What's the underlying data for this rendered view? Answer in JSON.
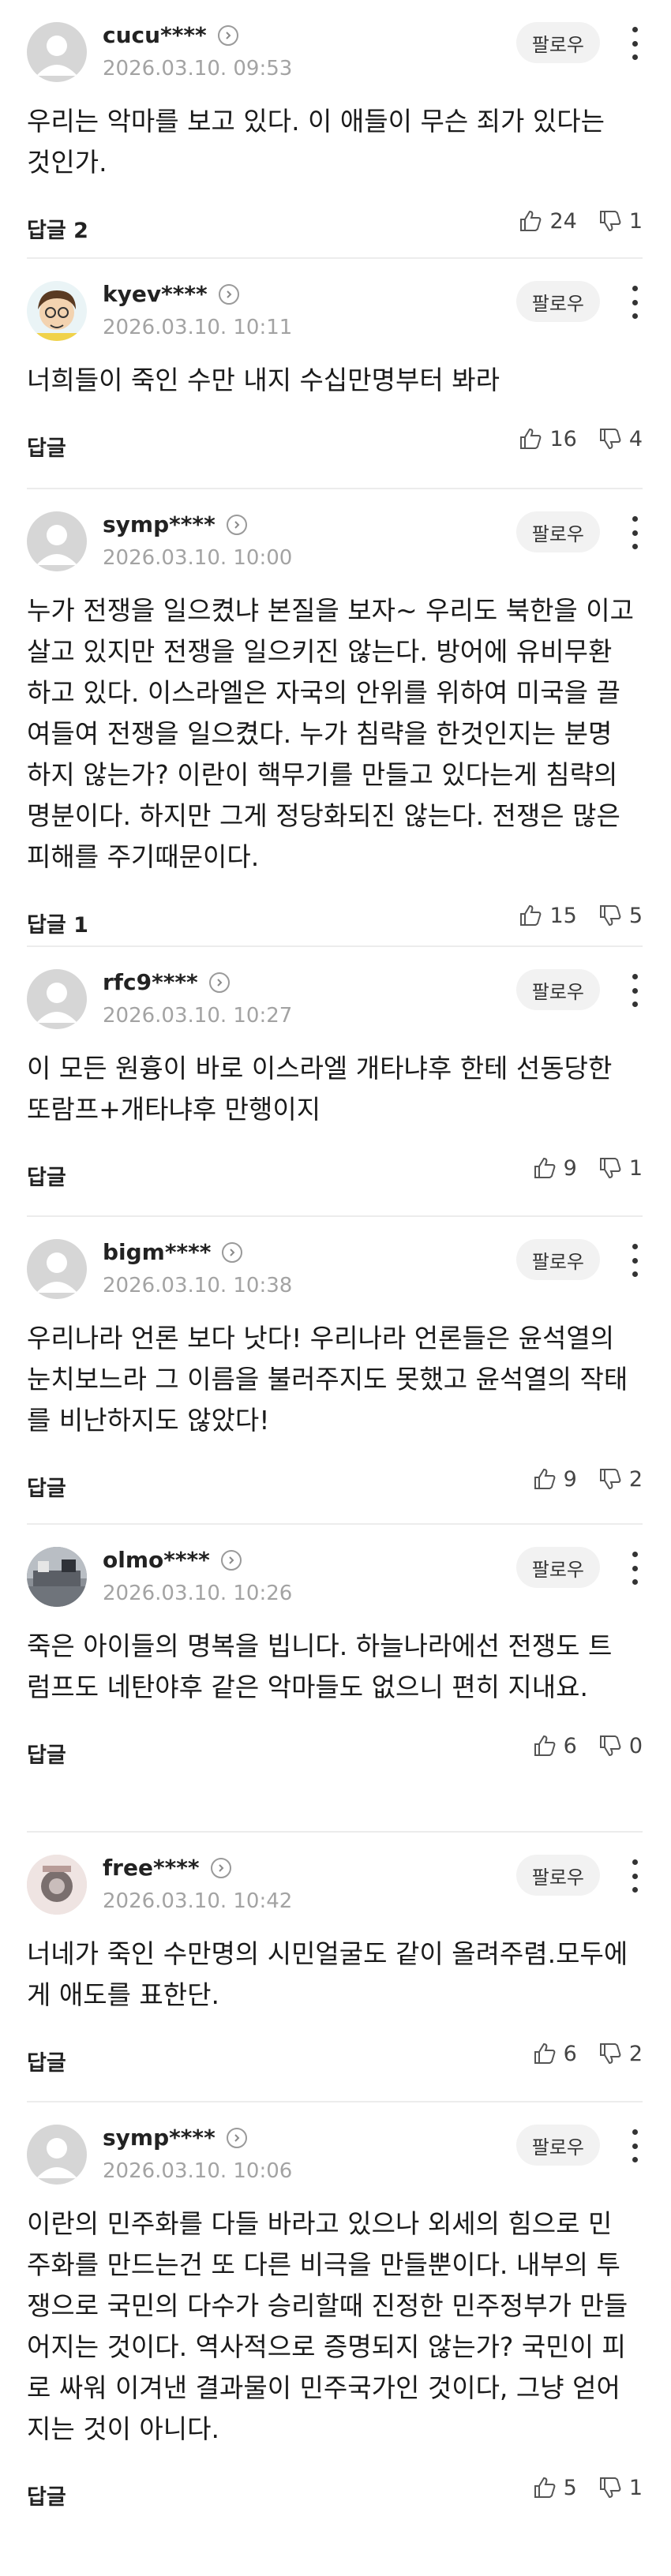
{
  "labels": {
    "follow": "팔로우",
    "reply": "답글"
  },
  "comments": [
    {
      "nick": "cucu****",
      "date": "2026.03.10. 09:53",
      "avatar": "default",
      "text": "우리는 악마를 보고 있다. 이 애들이 무슨 죄가 있다는 것인가.",
      "reply": "답글 2",
      "likes": "24",
      "dislikes": "1"
    },
    {
      "nick": "kyev****",
      "date": "2026.03.10. 10:11",
      "avatar": "cartoon",
      "text": "너희들이 죽인 수만 내지 수십만명부터 봐라",
      "reply": "답글",
      "likes": "16",
      "dislikes": "4"
    },
    {
      "nick": "symp****",
      "date": "2026.03.10. 10:00",
      "avatar": "default",
      "text": "누가 전쟁을 일으켰냐 본질을 보자~ 우리도 북한을 이고 살고 있지만 전쟁을 일으키진 않는다. 방어에 유비무환하고 있다. 이스라엘은 자국의 안위를 위하여 미국을 끌여들여 전쟁을 일으켰다. 누가 침략을 한것인지는 분명하지 않는가? 이란이 핵무기를 만들고 있다는게 침략의 명분이다. 하지만 그게 정당화되진 않는다. 전쟁은 많은 피해를 주기때문이다.",
      "reply": "답글 1",
      "likes": "15",
      "dislikes": "5"
    },
    {
      "nick": "rfc9****",
      "date": "2026.03.10. 10:27",
      "avatar": "default",
      "text": "이 모든 원흉이 바로 이스라엘 개타냐후 한테 선동당한 또람프+개타냐후 만행이지",
      "reply": "답글",
      "likes": "9",
      "dislikes": "1"
    },
    {
      "nick": "bigm****",
      "date": "2026.03.10. 10:38",
      "avatar": "default",
      "text": "우리나라 언론 보다 낫다! 우리나라 언론들은 윤석열의 눈치보느라 그 이름을 불러주지도 못했고 윤석열의 작태를 비난하지도 않았다!",
      "reply": "답글",
      "likes": "9",
      "dislikes": "2"
    },
    {
      "nick": "olmo****",
      "date": "2026.03.10. 10:26",
      "avatar": "photo-room",
      "text": "죽은 아이들의 명복을 빕니다. 하늘나라에선 전쟁도 트럼프도 네탄야후 같은 악마들도 없으니 편히 지내요.",
      "reply": "답글",
      "likes": "6",
      "dislikes": "0"
    },
    {
      "nick": "free****",
      "date": "2026.03.10. 10:42",
      "avatar": "photo-object",
      "text": "너네가 죽인 수만명의 시민얼굴도 같이 올려주렴.모두에게 애도를 표한단.",
      "reply": "답글",
      "likes": "6",
      "dislikes": "2"
    },
    {
      "nick": "symp****",
      "date": "2026.03.10. 10:06",
      "avatar": "default",
      "text": "이란의 민주화를 다들 바라고 있으나 외세의 힘으로 민주화를 만드는건 또 다른 비극을 만들뿐이다. 내부의 투쟁으로 국민의 다수가 승리할때 진정한 민주정부가 만들어지는 것이다. 역사적으로 증명되지 않는가? 국민이 피로 싸워 이겨낸 결과물이 민주국가인 것이다, 그냥 얻어지는 것이 아니다.",
      "reply": "답글",
      "likes": "5",
      "dislikes": "1"
    }
  ]
}
